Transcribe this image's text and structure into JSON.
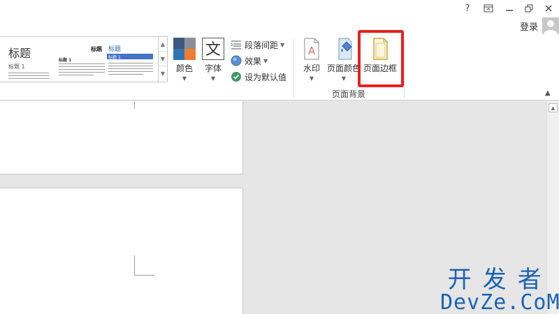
{
  "titlebar": {
    "help": "?",
    "login": "登录"
  },
  "gallery": {
    "thumb1": {
      "title": "标题",
      "heading1": "标题 1"
    },
    "thumb2": {
      "title": "标题",
      "heading1": "标题 1"
    },
    "thumb3": {
      "title": "标题",
      "heading1": "标题 1"
    }
  },
  "ribbon": {
    "colors": "颜色",
    "fonts": "字体",
    "paragraph_spacing": "段落间距",
    "effects": "效果",
    "set_default": "设为默认值",
    "watermark": "水印",
    "page_color": "页面颜色",
    "page_border": "页面边框",
    "group_page_background": "页面背景"
  },
  "watermark": {
    "line1": "开发者",
    "line2": "DevZe.CoM"
  },
  "colors": {
    "highlight": "#e8211f",
    "watermark": "#1a63b5",
    "theme_swatches": [
      "#3d5a80",
      "#8a8f99",
      "#2e75b6",
      "#ed7d31"
    ]
  }
}
